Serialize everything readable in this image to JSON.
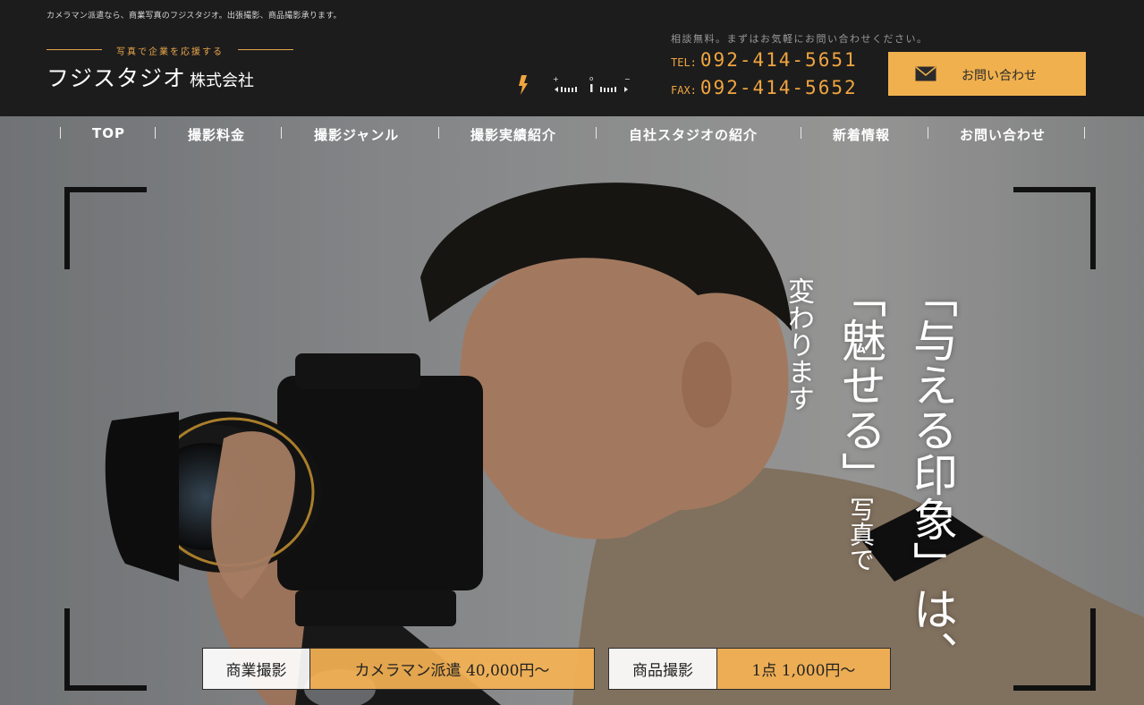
{
  "header": {
    "tagline": "カメラマン派遣なら、商業写真のフジスタジオ。出張撮影、商品撮影承ります。",
    "logo_sub": "写真で企業を応援する",
    "logo_main": "フジスタジオ",
    "logo_suffix": "株式会社",
    "consult_text": "相談無料。まずはお気軽にお問い合わせください。",
    "tel_label": "TEL:",
    "tel_number": "092-414-5651",
    "fax_label": "FAX:",
    "fax_number": "092-414-5652",
    "contact_button": "お問い合わせ",
    "icons": [
      "lightning-icon",
      "exposure-meter-icon",
      "envelope-icon"
    ]
  },
  "nav": {
    "items": [
      {
        "label": "TOP"
      },
      {
        "label": "撮影料金"
      },
      {
        "label": "撮影ジャンル"
      },
      {
        "label": "撮影実績紹介"
      },
      {
        "label": "自社スタジオの紹介"
      },
      {
        "label": "新着情報"
      },
      {
        "label": "お問い合わせ"
      }
    ]
  },
  "hero": {
    "copy_line1": "「与える印象」は、",
    "copy_line2_main": "「魅せる」",
    "copy_line2_tail": "写真で",
    "copy_line3": "変わります",
    "prices": [
      {
        "category": "商業撮影",
        "price": "カメラマン派遣 40,000円〜"
      },
      {
        "category": "商品撮影",
        "price": "1点 1,000円〜"
      }
    ]
  },
  "colors": {
    "accent": "#f0b04e",
    "header_bg": "#1c1c1c",
    "tel_color": "#f0a540"
  }
}
